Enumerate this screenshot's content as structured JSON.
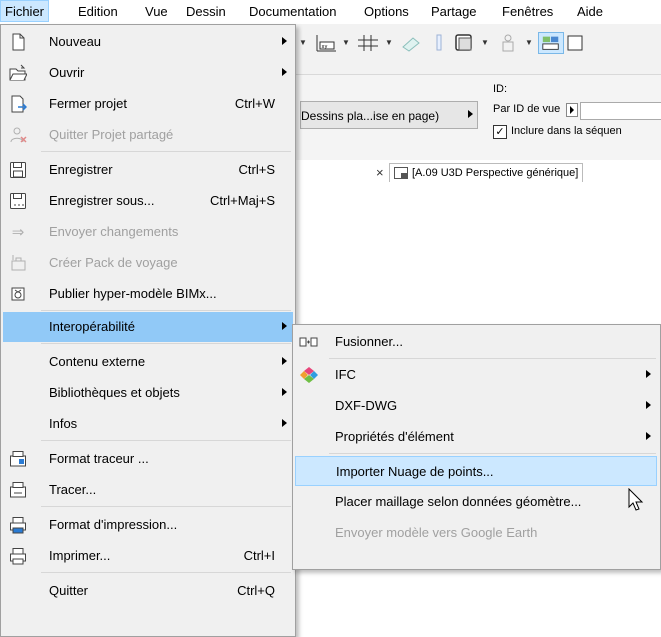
{
  "menubar": {
    "items": [
      "Fichier",
      "Edition",
      "Vue",
      "Dessin",
      "Documentation",
      "Options",
      "Partage",
      "Fenêtres",
      "Aide"
    ]
  },
  "background": {
    "breadcrumb_button": "Dessins pla...ise en page)",
    "id_label": "ID:",
    "id_by_view_label": "Par ID de vue",
    "include_checkbox_label": "Inclure dans la séquen",
    "include_checked": true,
    "tab_label": "[A.09 U3D Perspective générique]"
  },
  "file_menu": {
    "items": [
      {
        "label": "Nouveau",
        "shortcut": "",
        "submenu": true,
        "disabled": false,
        "icon": "new-document-icon"
      },
      {
        "label": "Ouvrir",
        "shortcut": "",
        "submenu": true,
        "disabled": false,
        "icon": "open-folder-icon"
      },
      {
        "label": "Fermer projet",
        "shortcut": "Ctrl+W",
        "submenu": false,
        "disabled": false,
        "icon": "close-project-icon"
      },
      {
        "label": "Quitter Projet partagé",
        "shortcut": "",
        "submenu": false,
        "disabled": true,
        "icon": "leave-shared-icon"
      },
      {
        "label": "Enregistrer",
        "shortcut": "Ctrl+S",
        "submenu": false,
        "disabled": false,
        "icon": "save-icon"
      },
      {
        "label": "Enregistrer sous...",
        "shortcut": "Ctrl+Maj+S",
        "submenu": false,
        "disabled": false,
        "icon": "save-as-icon"
      },
      {
        "label": "Envoyer changements",
        "shortcut": "",
        "submenu": false,
        "disabled": true,
        "icon": "send-changes-icon"
      },
      {
        "label": "Créer Pack de voyage",
        "shortcut": "",
        "submenu": false,
        "disabled": true,
        "icon": "travel-pack-icon"
      },
      {
        "label": "Publier hyper-modèle BIMx...",
        "shortcut": "",
        "submenu": false,
        "disabled": false,
        "icon": "bimx-icon"
      },
      {
        "label": "Interopérabilité",
        "shortcut": "",
        "submenu": true,
        "disabled": false,
        "icon": ""
      },
      {
        "label": "Contenu externe",
        "shortcut": "",
        "submenu": true,
        "disabled": false,
        "icon": ""
      },
      {
        "label": "Bibliothèques et objets",
        "shortcut": "",
        "submenu": true,
        "disabled": false,
        "icon": ""
      },
      {
        "label": "Infos",
        "shortcut": "",
        "submenu": true,
        "disabled": false,
        "icon": ""
      },
      {
        "label": "Format traceur ...",
        "shortcut": "",
        "submenu": false,
        "disabled": false,
        "icon": "plotter-setup-icon"
      },
      {
        "label": "Tracer...",
        "shortcut": "",
        "submenu": false,
        "disabled": false,
        "icon": "plot-icon"
      },
      {
        "label": "Format d'impression...",
        "shortcut": "",
        "submenu": false,
        "disabled": false,
        "icon": "page-setup-icon"
      },
      {
        "label": "Imprimer...",
        "shortcut": "Ctrl+I",
        "submenu": false,
        "disabled": false,
        "icon": "printer-icon"
      },
      {
        "label": "Quitter",
        "shortcut": "Ctrl+Q",
        "submenu": false,
        "disabled": false,
        "icon": ""
      }
    ]
  },
  "interop_menu": {
    "items": [
      {
        "label": "Fusionner...",
        "submenu": false,
        "disabled": false,
        "icon": "merge-icon"
      },
      {
        "label": "IFC",
        "submenu": true,
        "disabled": false,
        "icon": "ifc-icon"
      },
      {
        "label": "DXF-DWG",
        "submenu": true,
        "disabled": false,
        "icon": ""
      },
      {
        "label": "Propriétés d'élément",
        "submenu": true,
        "disabled": false,
        "icon": ""
      },
      {
        "label": "Importer Nuage de points...",
        "submenu": false,
        "disabled": false,
        "icon": ""
      },
      {
        "label": "Placer maillage selon données géomètre...",
        "submenu": false,
        "disabled": false,
        "icon": ""
      },
      {
        "label": "Envoyer modèle vers Google Earth",
        "submenu": false,
        "disabled": true,
        "icon": ""
      }
    ]
  },
  "colors": {
    "menu_bg": "#f0f0f0",
    "highlight": "#91c9f7",
    "hover": "#cce8ff",
    "disabled_text": "#a0a0a0"
  }
}
